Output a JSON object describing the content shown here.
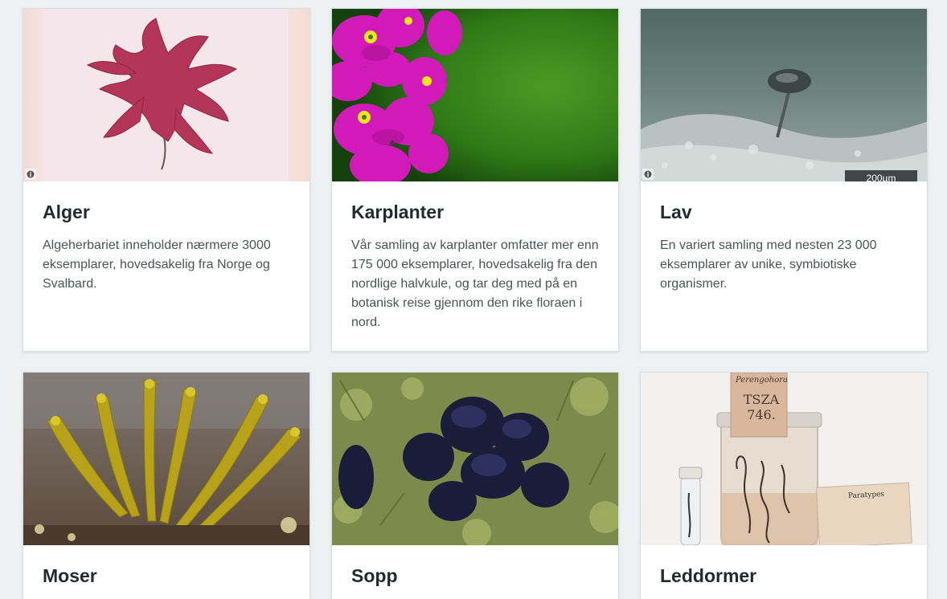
{
  "cards": [
    {
      "title": "Alger",
      "description": "Algeherbariet inneholder nærmere 3000 eksemplarer, hovedsakelig fra Norge og Svalbard.",
      "image_subject": "red algae herbarium specimen",
      "info_icon": "info-icon"
    },
    {
      "title": "Karplanter",
      "description": "Vår samling av karplanter omfatter mer enn 175 000 eksemplarer, hovedsakelig fra den nordlige halvkule, og tar deg med på en botanisk reise gjennom den rike floraen i nord.",
      "image_subject": "magenta primula flowers"
    },
    {
      "title": "Lav",
      "description": "En variert samling med nesten 23 000 eksemplarer av unike, symbiotiske organismer.",
      "image_subject": "lichen microscope image",
      "info_icon": "info-icon",
      "scale_label": "200µm"
    },
    {
      "title": "Moser",
      "description": "",
      "image_subject": "yellow-green moss"
    },
    {
      "title": "Sopp",
      "description": "",
      "image_subject": "black cup fungi",
      "info_icon": "info-icon"
    },
    {
      "title": "Leddormer",
      "description": "",
      "image_subject": "specimen jar with label",
      "jar_labels": [
        "Perengohora",
        "TSZA",
        "746.",
        "Paratypes"
      ]
    }
  ]
}
